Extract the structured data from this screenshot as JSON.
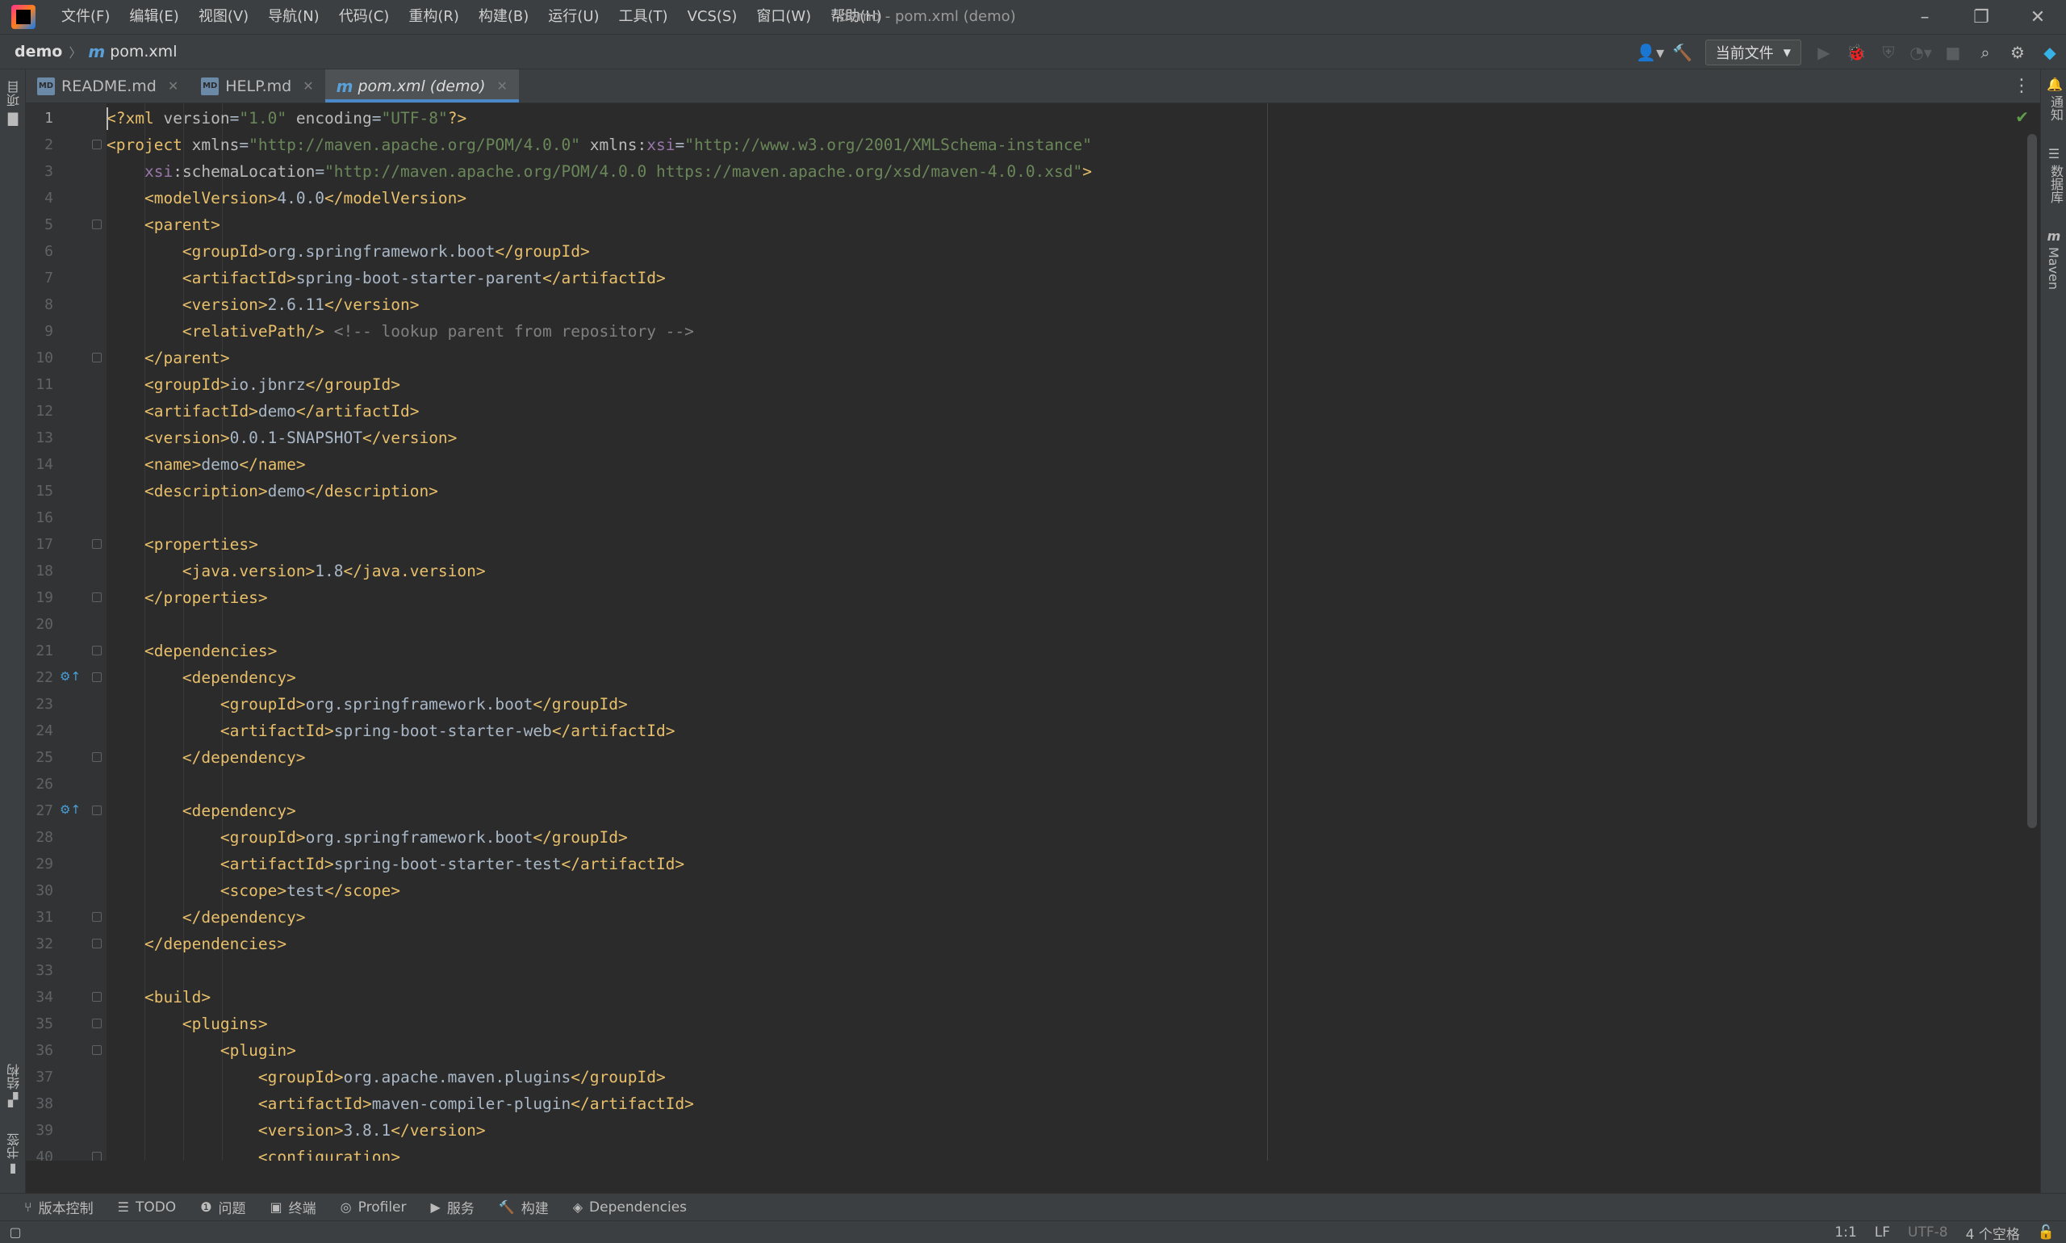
{
  "menu": [
    "文件(F)",
    "编辑(E)",
    "视图(V)",
    "导航(N)",
    "代码(C)",
    "重构(R)",
    "构建(B)",
    "运行(U)",
    "工具(T)",
    "VCS(S)",
    "窗口(W)",
    "帮助(H)"
  ],
  "window_title": "demo - pom.xml (demo)",
  "breadcrumb": {
    "project": "demo",
    "file": "pom.xml"
  },
  "run_config": "当前文件",
  "left_strip": {
    "project": "项目",
    "structure": "结构",
    "bookmarks": "书签"
  },
  "right_strip": {
    "notifications": "通知",
    "database": "数据库",
    "maven": "Maven"
  },
  "tabs": [
    {
      "label": "README.md",
      "icon": "markdown-icon",
      "active": false
    },
    {
      "label": "HELP.md",
      "icon": "markdown-icon",
      "active": false
    },
    {
      "label": "pom.xml (demo)",
      "icon": "maven-icon",
      "active": true
    }
  ],
  "editor": {
    "file": "pom.xml",
    "current_line": 1,
    "lines": [
      [
        [
          "p",
          "<?"
        ],
        [
          "t",
          "xml "
        ],
        [
          "a",
          "version"
        ],
        [
          "x",
          "="
        ],
        [
          "s",
          "\"1.0\""
        ],
        [
          "a",
          " encoding"
        ],
        [
          "x",
          "="
        ],
        [
          "s",
          "\"UTF-8\""
        ],
        [
          "p",
          "?>"
        ]
      ],
      [
        [
          "t",
          "<project "
        ],
        [
          "a",
          "xmlns"
        ],
        [
          "x",
          "="
        ],
        [
          "s",
          "\"http://maven.apache.org/POM/4.0.0\""
        ],
        [
          "a",
          " xmlns:"
        ],
        [
          "ns",
          "xsi"
        ],
        [
          "x",
          "="
        ],
        [
          "s",
          "\"http://www.w3.org/2001/XMLSchema-instance\""
        ]
      ],
      [
        [
          "x",
          "    "
        ],
        [
          "ns",
          "xsi"
        ],
        [
          "a",
          ":schemaLocation"
        ],
        [
          "x",
          "="
        ],
        [
          "s",
          "\"http://maven.apache.org/POM/4.0.0 https://maven.apache.org/xsd/maven-4.0.0.xsd\""
        ],
        [
          "t",
          ">"
        ]
      ],
      [
        [
          "x",
          "    "
        ],
        [
          "t",
          "<modelVersion>"
        ],
        [
          "x",
          "4.0.0"
        ],
        [
          "t",
          "</modelVersion>"
        ]
      ],
      [
        [
          "x",
          "    "
        ],
        [
          "t",
          "<parent>"
        ]
      ],
      [
        [
          "x",
          "        "
        ],
        [
          "t",
          "<groupId>"
        ],
        [
          "x",
          "org.springframework.boot"
        ],
        [
          "t",
          "</groupId>"
        ]
      ],
      [
        [
          "x",
          "        "
        ],
        [
          "t",
          "<artifactId>"
        ],
        [
          "x",
          "spring-boot-starter-parent"
        ],
        [
          "t",
          "</artifactId>"
        ]
      ],
      [
        [
          "x",
          "        "
        ],
        [
          "t",
          "<version>"
        ],
        [
          "x",
          "2.6.11"
        ],
        [
          "t",
          "</version>"
        ]
      ],
      [
        [
          "x",
          "        "
        ],
        [
          "t",
          "<relativePath/>"
        ],
        [
          "c",
          " <!-- lookup parent from repository -->"
        ]
      ],
      [
        [
          "x",
          "    "
        ],
        [
          "t",
          "</parent>"
        ]
      ],
      [
        [
          "x",
          "    "
        ],
        [
          "t",
          "<groupId>"
        ],
        [
          "x",
          "io.jbnrz"
        ],
        [
          "t",
          "</groupId>"
        ]
      ],
      [
        [
          "x",
          "    "
        ],
        [
          "t",
          "<artifactId>"
        ],
        [
          "x",
          "demo"
        ],
        [
          "t",
          "</artifactId>"
        ]
      ],
      [
        [
          "x",
          "    "
        ],
        [
          "t",
          "<version>"
        ],
        [
          "x",
          "0.0.1-SNAPSHOT"
        ],
        [
          "t",
          "</version>"
        ]
      ],
      [
        [
          "x",
          "    "
        ],
        [
          "t",
          "<name>"
        ],
        [
          "x",
          "demo"
        ],
        [
          "t",
          "</name>"
        ]
      ],
      [
        [
          "x",
          "    "
        ],
        [
          "t",
          "<description>"
        ],
        [
          "x",
          "demo"
        ],
        [
          "t",
          "</description>"
        ]
      ],
      [],
      [
        [
          "x",
          "    "
        ],
        [
          "t",
          "<properties>"
        ]
      ],
      [
        [
          "x",
          "        "
        ],
        [
          "t",
          "<java.version>"
        ],
        [
          "x",
          "1.8"
        ],
        [
          "t",
          "</java.version>"
        ]
      ],
      [
        [
          "x",
          "    "
        ],
        [
          "t",
          "</properties>"
        ]
      ],
      [],
      [
        [
          "x",
          "    "
        ],
        [
          "t",
          "<dependencies>"
        ]
      ],
      [
        [
          "x",
          "        "
        ],
        [
          "t",
          "<dependency>"
        ]
      ],
      [
        [
          "x",
          "            "
        ],
        [
          "t",
          "<groupId>"
        ],
        [
          "x",
          "org.springframework.boot"
        ],
        [
          "t",
          "</groupId>"
        ]
      ],
      [
        [
          "x",
          "            "
        ],
        [
          "t",
          "<artifactId>"
        ],
        [
          "x",
          "spring-boot-starter-web"
        ],
        [
          "t",
          "</artifactId>"
        ]
      ],
      [
        [
          "x",
          "        "
        ],
        [
          "t",
          "</dependency>"
        ]
      ],
      [],
      [
        [
          "x",
          "        "
        ],
        [
          "t",
          "<dependency>"
        ]
      ],
      [
        [
          "x",
          "            "
        ],
        [
          "t",
          "<groupId>"
        ],
        [
          "x",
          "org.springframework.boot"
        ],
        [
          "t",
          "</groupId>"
        ]
      ],
      [
        [
          "x",
          "            "
        ],
        [
          "t",
          "<artifactId>"
        ],
        [
          "x",
          "spring-boot-starter-test"
        ],
        [
          "t",
          "</artifactId>"
        ]
      ],
      [
        [
          "x",
          "            "
        ],
        [
          "t",
          "<scope>"
        ],
        [
          "x",
          "test"
        ],
        [
          "t",
          "</scope>"
        ]
      ],
      [
        [
          "x",
          "        "
        ],
        [
          "t",
          "</dependency>"
        ]
      ],
      [
        [
          "x",
          "    "
        ],
        [
          "t",
          "</dependencies>"
        ]
      ],
      [],
      [
        [
          "x",
          "    "
        ],
        [
          "t",
          "<build>"
        ]
      ],
      [
        [
          "x",
          "        "
        ],
        [
          "t",
          "<plugins>"
        ]
      ],
      [
        [
          "x",
          "            "
        ],
        [
          "t",
          "<plugin>"
        ]
      ],
      [
        [
          "x",
          "                "
        ],
        [
          "t",
          "<groupId>"
        ],
        [
          "x",
          "org.apache.maven.plugins"
        ],
        [
          "t",
          "</groupId>"
        ]
      ],
      [
        [
          "x",
          "                "
        ],
        [
          "t",
          "<artifactId>"
        ],
        [
          "x",
          "maven-compiler-plugin"
        ],
        [
          "t",
          "</artifactId>"
        ]
      ],
      [
        [
          "x",
          "                "
        ],
        [
          "t",
          "<version>"
        ],
        [
          "x",
          "3.8.1"
        ],
        [
          "t",
          "</version>"
        ]
      ],
      [
        [
          "x",
          "                "
        ],
        [
          "t",
          "<configuration>"
        ]
      ]
    ],
    "fold_lines": [
      2,
      5,
      10,
      17,
      19,
      21,
      22,
      25,
      27,
      31,
      32,
      34,
      35,
      36,
      40
    ],
    "gutter_mark_lines": [
      22,
      27
    ]
  },
  "bottom_tools": [
    {
      "label": "版本控制",
      "icon": "branch-icon"
    },
    {
      "label": "TODO",
      "icon": "list-icon"
    },
    {
      "label": "问题",
      "icon": "problems-icon"
    },
    {
      "label": "终端",
      "icon": "terminal-icon"
    },
    {
      "label": "Profiler",
      "icon": "profiler-icon"
    },
    {
      "label": "服务",
      "icon": "services-icon"
    },
    {
      "label": "构建",
      "icon": "build-icon"
    },
    {
      "label": "Dependencies",
      "icon": "dependencies-icon"
    }
  ],
  "status": {
    "position": "1:1",
    "line_separator": "LF",
    "encoding": "UTF-8",
    "indent": "4 个空格"
  }
}
